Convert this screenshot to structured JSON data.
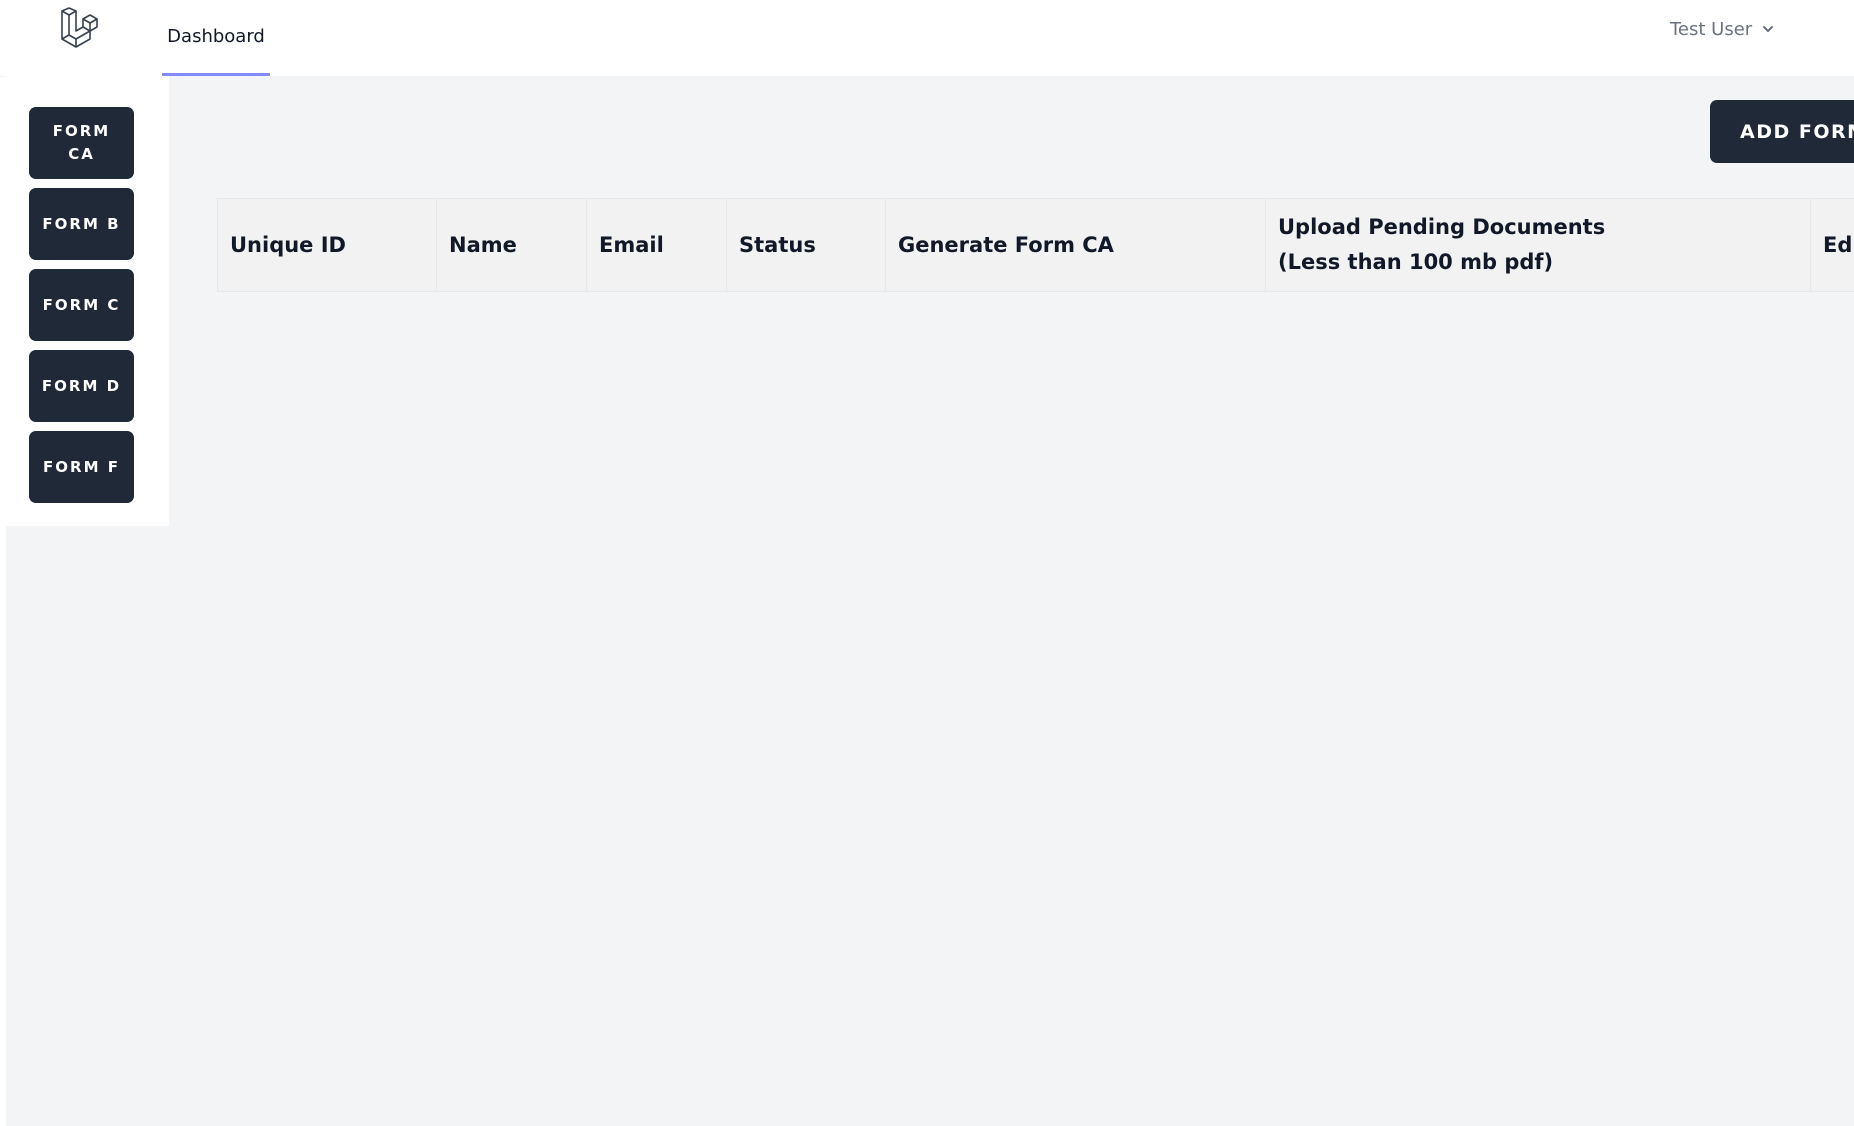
{
  "nav": {
    "dashboard_label": "Dashboard",
    "user_name": "Test User"
  },
  "sidebar": {
    "items": [
      {
        "label": "FORM CA"
      },
      {
        "label": "FORM B"
      },
      {
        "label": "FORM C"
      },
      {
        "label": "FORM D"
      },
      {
        "label": "FORM F"
      }
    ]
  },
  "actions": {
    "add_form_label": "ADD FORM"
  },
  "table": {
    "headers": [
      "Unique ID",
      "Name",
      "Email",
      "Status",
      "Generate Form CA",
      "Upload Pending Documents (Less than 100 mb pdf)",
      "Edi"
    ],
    "rows": []
  },
  "colors": {
    "button_bg": "#1f2937",
    "accent_underline": "#818cf8",
    "page_bg": "#f3f4f6"
  }
}
